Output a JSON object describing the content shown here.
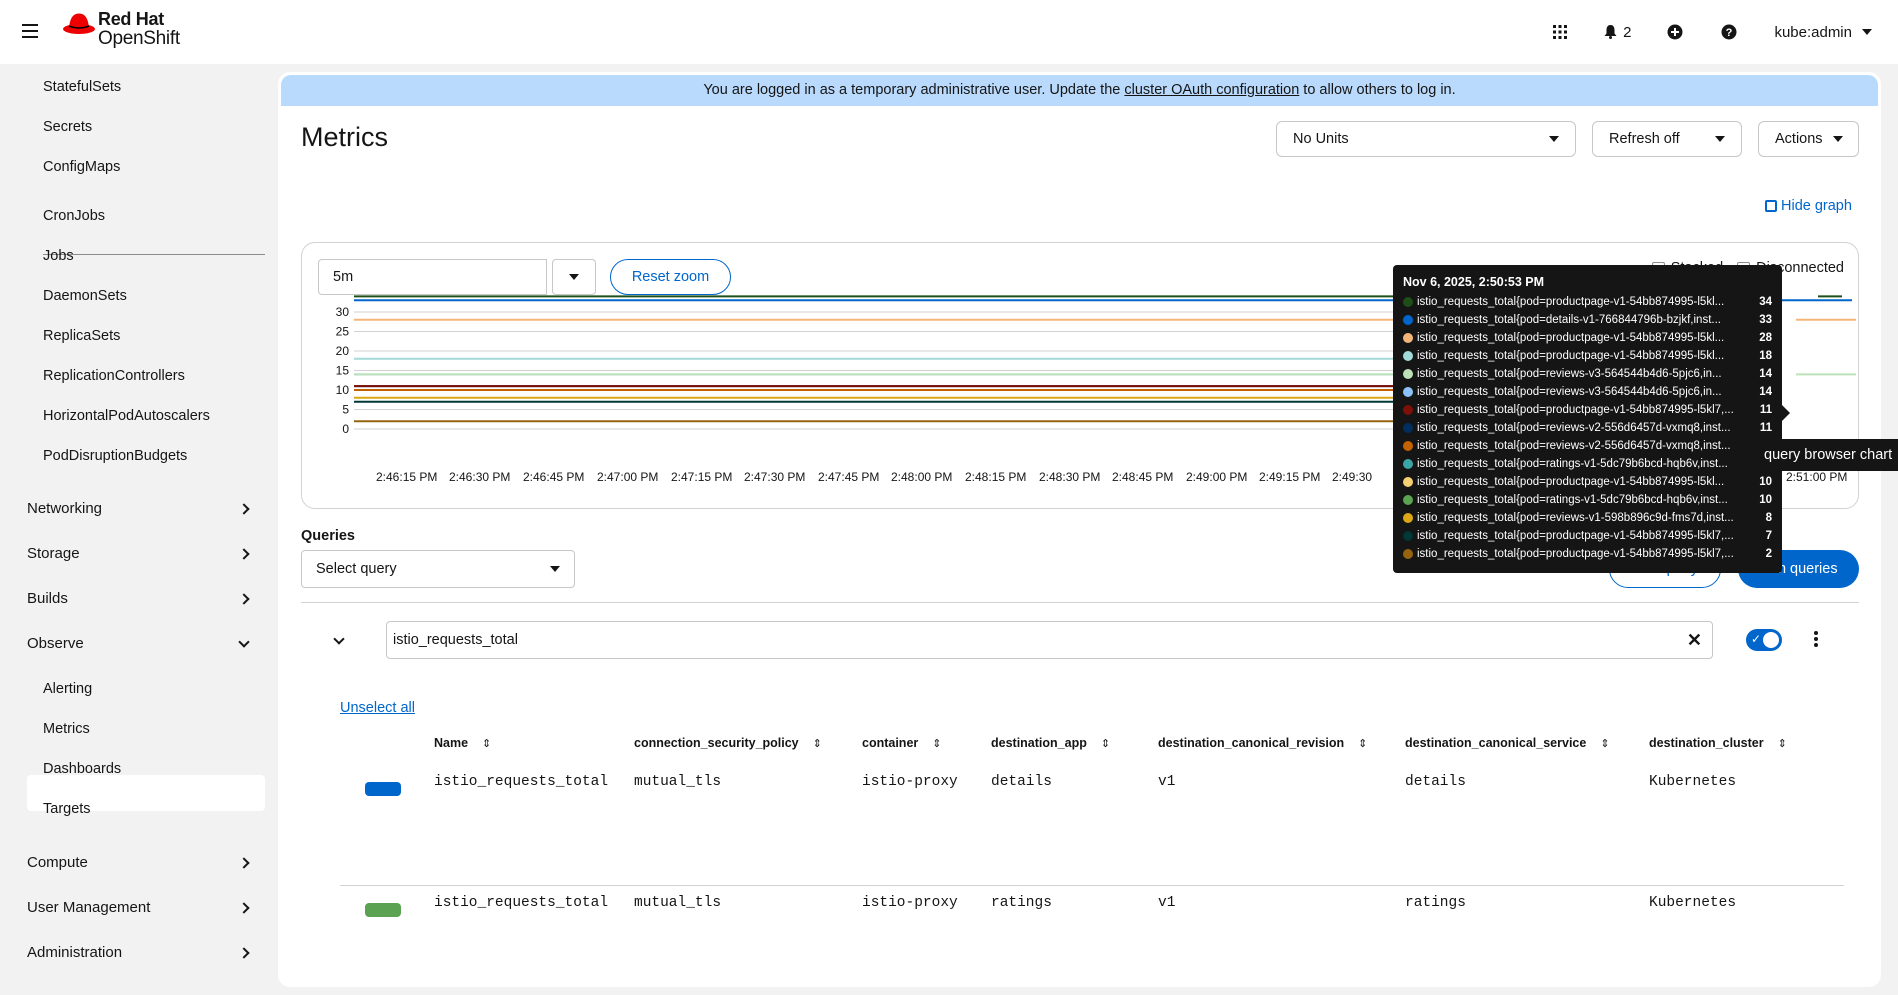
{
  "masthead": {
    "brand_line1": "Red Hat",
    "brand_line2": "OpenShift",
    "notification_count": "2",
    "user": "kube:admin"
  },
  "sidebar": {
    "workloads": [
      "StatefulSets",
      "Secrets",
      "ConfigMaps",
      "CronJobs",
      "Jobs",
      "DaemonSets",
      "ReplicaSets",
      "ReplicationControllers",
      "HorizontalPodAutoscalers",
      "PodDisruptionBudgets"
    ],
    "sections": {
      "networking": "Networking",
      "storage": "Storage",
      "builds": "Builds",
      "observe": "Observe",
      "compute": "Compute",
      "user_management": "User Management",
      "administration": "Administration"
    },
    "observe_items": [
      "Alerting",
      "Metrics",
      "Dashboards",
      "Targets"
    ],
    "active_item": "Metrics"
  },
  "banner": {
    "text_before": "You are logged in as a temporary administrative user. Update the ",
    "link": "cluster OAuth configuration",
    "text_after": " to allow others to log in."
  },
  "page": {
    "title": "Metrics",
    "units_dropdown": "No Units",
    "refresh_dropdown": "Refresh off",
    "actions_dropdown": "Actions",
    "hide_graph": "Hide graph"
  },
  "graph": {
    "span": "5m",
    "reset_zoom": "Reset zoom",
    "stacked_label": "Stacked",
    "disconnected_label": "Disconnected",
    "tooltip_label": "query browser chart"
  },
  "chart_data": {
    "type": "line",
    "y_ticks": [
      "0",
      "5",
      "10",
      "15",
      "20",
      "25",
      "30"
    ],
    "ylim": [
      0,
      35
    ],
    "x_ticks": [
      "2:46:15 PM",
      "2:46:30 PM",
      "2:46:45 PM",
      "2:47:00 PM",
      "2:47:15 PM",
      "2:47:30 PM",
      "2:47:45 PM",
      "2:48:00 PM",
      "2:48:15 PM",
      "2:48:30 PM",
      "2:48:45 PM",
      "2:49:00 PM",
      "2:49:15 PM",
      "2:49:30",
      "2:51:00 PM"
    ],
    "tooltip_time": "Nov 6, 2025, 2:50:53 PM",
    "series": [
      {
        "name": "istio_requests_total{pod=productpage-v1-54bb874995-l5kl...",
        "color": "#1e4f18",
        "value": 34
      },
      {
        "name": "istio_requests_total{pod=details-v1-766844796b-bzjkf,inst...",
        "color": "#0066cc",
        "value": 33
      },
      {
        "name": "istio_requests_total{pod=productpage-v1-54bb874995-l5kl...",
        "color": "#f4b678",
        "value": 28
      },
      {
        "name": "istio_requests_total{pod=productpage-v1-54bb874995-l5kl...",
        "color": "#a2d9d9",
        "value": 18
      },
      {
        "name": "istio_requests_total{pod=reviews-v3-564544b4d6-5pjc6,in...",
        "color": "#bde2b9",
        "value": 14
      },
      {
        "name": "istio_requests_total{pod=reviews-v3-564544b4d6-5pjc6,in...",
        "color": "#8bc1f7",
        "value": 14
      },
      {
        "name": "istio_requests_total{pod=productpage-v1-54bb874995-l5kl7,...",
        "color": "#7d1007",
        "value": 11
      },
      {
        "name": "istio_requests_total{pod=reviews-v2-556d6457d-vxmq8,inst...",
        "color": "#002f5d",
        "value": 11
      },
      {
        "name": "istio_requests_total{pod=reviews-v2-556d6457d-vxmq8,inst...",
        "color": "#c46100",
        "value": 10
      },
      {
        "name": "istio_requests_total{pod=ratings-v1-5dc79b6bcd-hqb6v,inst...",
        "color": "#3ca5a5",
        "value": 10
      },
      {
        "name": "istio_requests_total{pod=productpage-v1-54bb874995-l5kl...",
        "color": "#f6d173",
        "value": 10
      },
      {
        "name": "istio_requests_total{pod=ratings-v1-5dc79b6bcd-hqb6v,inst...",
        "color": "#5ba352",
        "value": 10
      },
      {
        "name": "istio_requests_total{pod=reviews-v1-598b896c9d-fms7d,inst...",
        "color": "#dca614",
        "value": 8
      },
      {
        "name": "istio_requests_total{pod=productpage-v1-54bb874995-l5kl7,...",
        "color": "#003737",
        "value": 7
      },
      {
        "name": "istio_requests_total{pod=productpage-v1-54bb874995-l5kl7,...",
        "color": "#96640f",
        "value": 2
      }
    ]
  },
  "queries": {
    "label": "Queries",
    "select_placeholder": "Select query",
    "add_query": "Add query",
    "run_queries": "Run queries",
    "expression": "istio_requests_total",
    "unselect_all": "Unselect all"
  },
  "table": {
    "columns": [
      "Name",
      "connection_security_policy",
      "container",
      "destination_app",
      "destination_canonical_revision",
      "destination_canonical_service",
      "destination_cluster"
    ],
    "rows": [
      {
        "color": "#0066cc",
        "cells": [
          "istio_requests_total",
          "mutual_tls",
          "istio-proxy",
          "details",
          "v1",
          "details",
          "Kubernetes"
        ]
      },
      {
        "color": "#5ba352",
        "cells": [
          "istio_requests_total",
          "mutual_tls",
          "istio-proxy",
          "ratings",
          "v1",
          "ratings",
          "Kubernetes"
        ]
      }
    ]
  }
}
